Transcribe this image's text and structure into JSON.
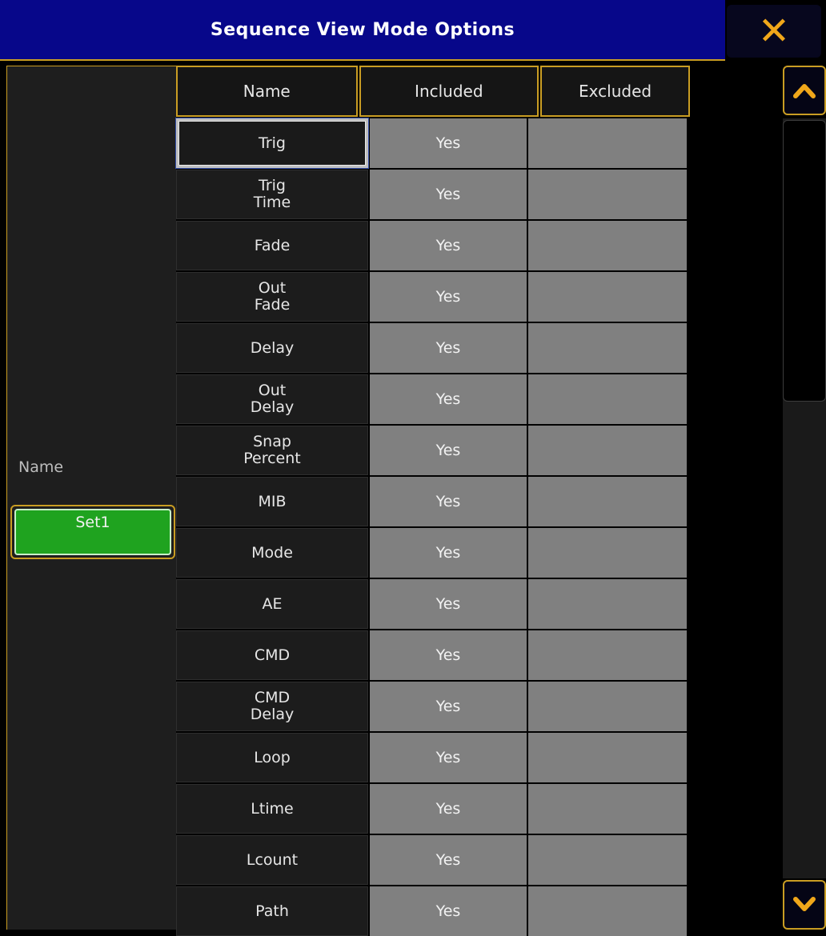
{
  "window": {
    "title": "Sequence View Mode Options",
    "close_glyph": "✕"
  },
  "left_panel": {
    "name_label": "Name",
    "set_button_label": "Set1"
  },
  "table": {
    "headers": [
      "Name",
      "Included",
      "Excluded"
    ],
    "selected_row": 0,
    "rows": [
      {
        "name": "Trig",
        "included": "Yes",
        "excluded": ""
      },
      {
        "name": "Trig\nTime",
        "included": "Yes",
        "excluded": ""
      },
      {
        "name": "Fade",
        "included": "Yes",
        "excluded": ""
      },
      {
        "name": "Out\nFade",
        "included": "Yes",
        "excluded": ""
      },
      {
        "name": "Delay",
        "included": "Yes",
        "excluded": ""
      },
      {
        "name": "Out\nDelay",
        "included": "Yes",
        "excluded": ""
      },
      {
        "name": "Snap\nPercent",
        "included": "Yes",
        "excluded": ""
      },
      {
        "name": "MIB",
        "included": "Yes",
        "excluded": ""
      },
      {
        "name": "Mode",
        "included": "Yes",
        "excluded": ""
      },
      {
        "name": "AE",
        "included": "Yes",
        "excluded": ""
      },
      {
        "name": "CMD",
        "included": "Yes",
        "excluded": ""
      },
      {
        "name": "CMD\nDelay",
        "included": "Yes",
        "excluded": ""
      },
      {
        "name": "Loop",
        "included": "Yes",
        "excluded": ""
      },
      {
        "name": "Ltime",
        "included": "Yes",
        "excluded": ""
      },
      {
        "name": "Lcount",
        "included": "Yes",
        "excluded": ""
      },
      {
        "name": "Path",
        "included": "Yes",
        "excluded": ""
      }
    ]
  },
  "scrollbar": {
    "up_icon": "chevron-up-icon",
    "down_icon": "chevron-down-icon"
  },
  "colors": {
    "title_bar": "#07078a",
    "accent_border": "#c99d23",
    "close_glyph": "#f0a71a",
    "set_button": "#1fa31f",
    "cell_value": "#808080"
  }
}
